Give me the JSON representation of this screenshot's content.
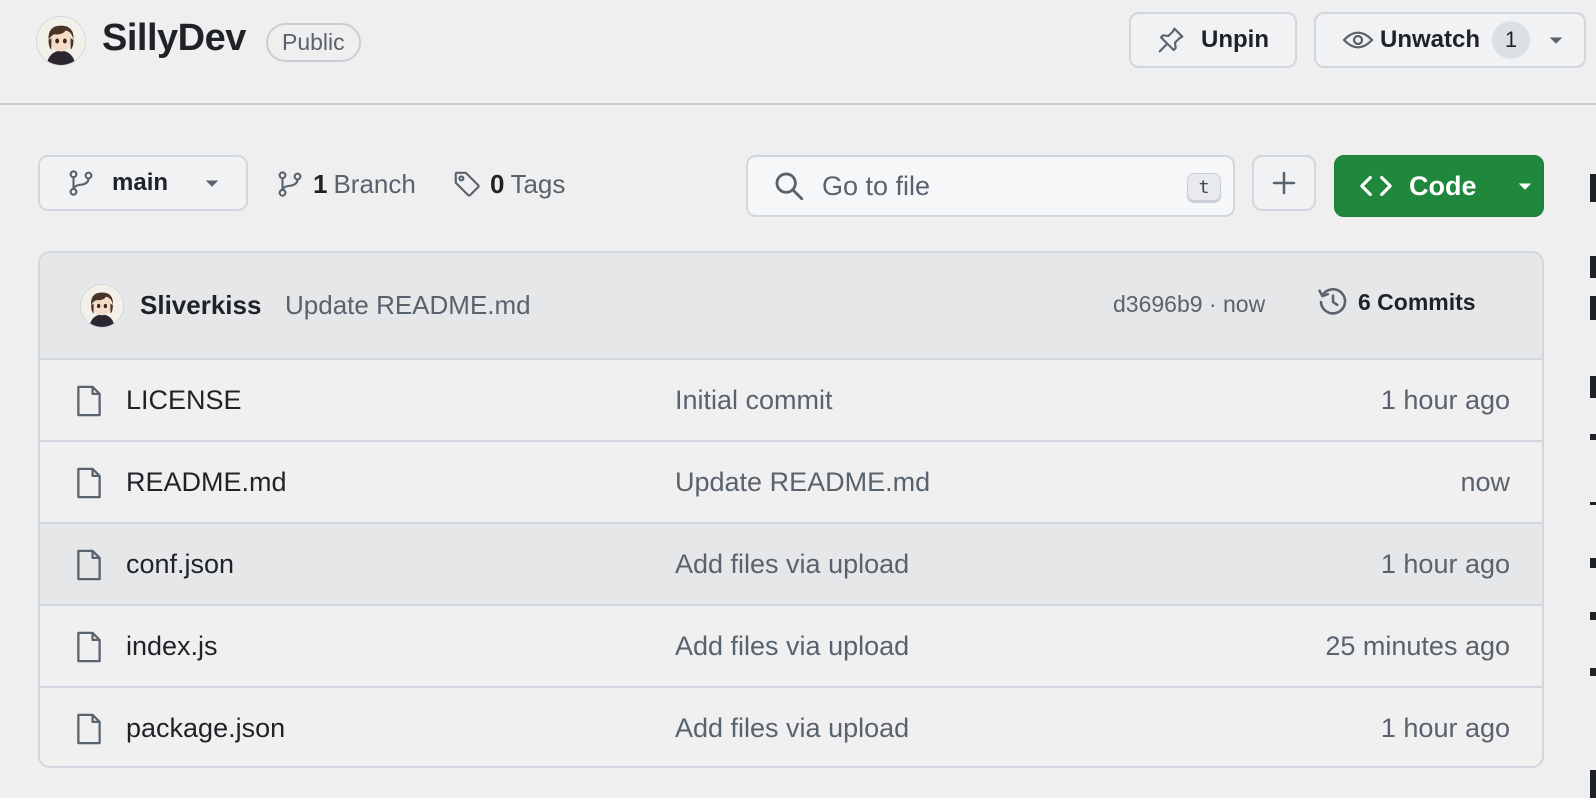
{
  "repo": {
    "name": "SillyDev",
    "visibility": "Public",
    "owner_avatar_icon": "anime-avatar-icon"
  },
  "actions": {
    "unpin_label": "Unpin",
    "unwatch_label": "Unwatch",
    "watch_count": "1"
  },
  "toolbar": {
    "branch": "main",
    "branch_count": "1",
    "branch_label": "Branch",
    "tag_count": "0",
    "tag_label": "Tags",
    "search_placeholder": "Go to file",
    "search_shortcut": "t",
    "add_file_label": "+",
    "code_label": "Code"
  },
  "latest_commit": {
    "author": "Sliverkiss",
    "message": "Update README.md",
    "hash": "d3696b9",
    "time": "now",
    "info": "d3696b9 · now",
    "commit_count": "6",
    "commit_label": "Commits",
    "commits_text": "6 Commits"
  },
  "files": [
    {
      "name": "LICENSE",
      "commit": "Initial commit",
      "time": "1 hour ago"
    },
    {
      "name": "README.md",
      "commit": "Update README.md",
      "time": "now"
    },
    {
      "name": "conf.json",
      "commit": "Add files via upload",
      "time": "1 hour ago"
    },
    {
      "name": "index.js",
      "commit": "Add files via upload",
      "time": "25 minutes ago"
    },
    {
      "name": "package.json",
      "commit": "Add files via upload",
      "time": "1 hour ago"
    }
  ],
  "colors": {
    "primary_green": "#1f883d",
    "muted_text": "#59636e",
    "border": "#d0d7de"
  }
}
